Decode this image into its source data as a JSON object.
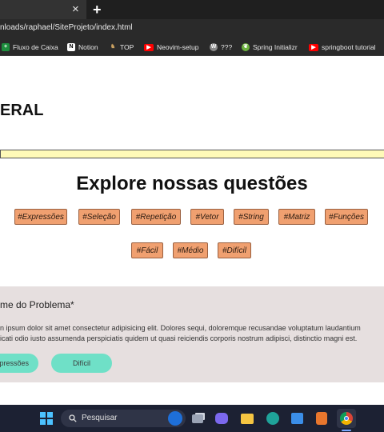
{
  "browser": {
    "tab_close": "×",
    "new_tab": "+",
    "url": "nloads/raphael/SiteProjeto/index.html",
    "bookmarks": [
      {
        "label": "Fluxo de Caixa",
        "icon": "sheets-icon",
        "color": "#1e8e3e"
      },
      {
        "label": "Notion",
        "icon": "notion-icon",
        "color": "#ffffff",
        "glyph": "N"
      },
      {
        "label": "TOP",
        "icon": "deer-icon",
        "color": "#c8a060"
      },
      {
        "label": "Neovim-setup",
        "icon": "youtube-icon",
        "color": "#ff0000"
      },
      {
        "label": "???",
        "icon": "wordpress-icon",
        "color": "#8a8a8a"
      },
      {
        "label": "Spring Initializr",
        "icon": "spring-icon",
        "color": "#6db33f"
      },
      {
        "label": "springboot tutorial",
        "icon": "youtube-icon",
        "color": "#ff0000"
      }
    ]
  },
  "page": {
    "site_title": "ERAL",
    "explore_title": "Explore nossas questões",
    "category_tags": [
      "#Expressões",
      "#Seleção",
      "#Repetição",
      "#Vetor",
      "#String",
      "#Matriz",
      "#Funções"
    ],
    "difficulty_tags": [
      "#Fácil",
      "#Médio",
      "#Difícil"
    ],
    "problem": {
      "title": "me do Problema*",
      "description_line1": "n ipsum dolor sit amet consectetur adipisicing elit. Dolores sequi, doloremque recusandae voluptatum laudantium",
      "description_line2": "icati odio iusto assumenda perspiciatis quidem ut quasi reiciendis corporis nostrum adipisci, distinctio magni est.",
      "tag1": "pressões",
      "tag2": "Difícil"
    }
  },
  "taskbar": {
    "search_placeholder": "Pesquisar"
  },
  "colors": {
    "tag_bg": "#f0a070",
    "pill_bg": "#6fe0c7",
    "card_bg": "#e6dfdf",
    "banner": "#fffab8",
    "taskbar": "#1c2133"
  }
}
